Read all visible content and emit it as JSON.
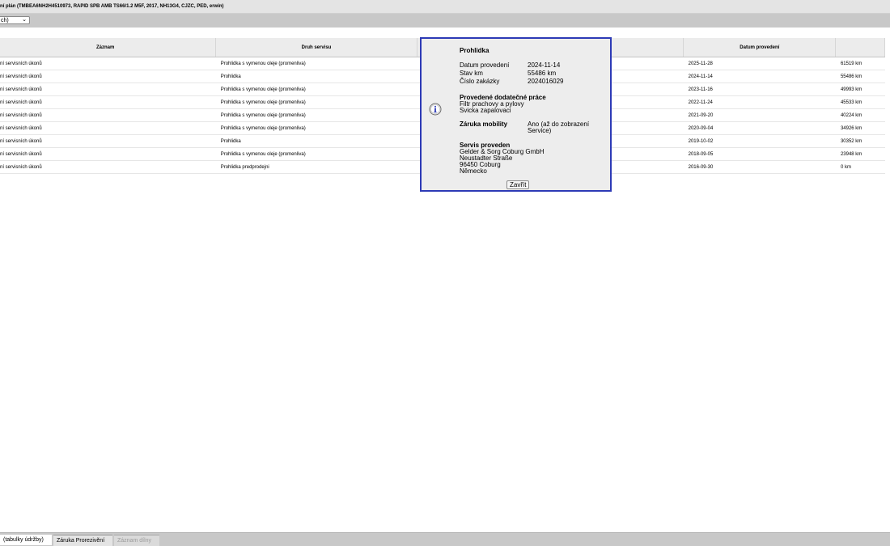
{
  "window": {
    "title": "ní plán (TMBEA6NH2H4510973, RAPID SPB AMB TS66/1.2 M5F, 2017, NH13G4, CJZC, PED, erwin)"
  },
  "toolbar": {
    "filter_value": "ch)"
  },
  "table": {
    "headers": [
      "Záznam",
      "Druh servisu",
      "",
      "Datum provedení",
      ""
    ],
    "rows": [
      {
        "record": "ní servisních úkonů",
        "type": "Prohlidka s vymenou oleje (promenliva)",
        "date": "2025-11-28",
        "km": "61519 km"
      },
      {
        "record": "ní servisních úkonů",
        "type": "Prohlidka",
        "date": "2024-11-14",
        "km": "55486 km"
      },
      {
        "record": "ní servisních úkonů",
        "type": "Prohlidka s vymenou oleje (promenliva)",
        "date": "2023-11-16",
        "km": "49993 km"
      },
      {
        "record": "ní servisních úkonů",
        "type": "Prohlidka s vymenou oleje (promenliva)",
        "date": "2022-11-24",
        "km": "45533 km"
      },
      {
        "record": "ní servisních úkonů",
        "type": "Prohlidka s vymenou oleje (promenliva)",
        "date": "2021-09-20",
        "km": "40224 km"
      },
      {
        "record": "ní servisních úkonů",
        "type": "Prohlidka s vymenou oleje (promenliva)",
        "date": "2020-09-04",
        "km": "34926 km"
      },
      {
        "record": "ní servisních úkonů",
        "type": "Prohlidka",
        "date": "2019-10-02",
        "km": "30352 km"
      },
      {
        "record": "ní servisních úkonů",
        "type": "Prohlidka s vymenou oleje (promenliva)",
        "date": "2018-09-05",
        "km": "23948 km"
      },
      {
        "record": "ní servisních úkonů",
        "type": "Prohlidka predprodejni",
        "date": "2016-09-30",
        "km": "0 km"
      }
    ]
  },
  "popup": {
    "title": "Prohlidka",
    "date_label": "Datum provedení",
    "date_value": "2024-11-14",
    "km_label": "Stav km",
    "km_value": "55486 km",
    "order_label": "Číslo zakázky",
    "order_value": "2024016029",
    "extra_heading": "Provedené dodatečné práce",
    "extra_items": [
      "Filtr prachovy a pylovy",
      "Svicka zapalovaci"
    ],
    "mobility_label": "Záruka mobility",
    "mobility_value_line1": "Ano (až do zobrazení",
    "mobility_value_line2": "Service)",
    "service_heading": "Servis proveden",
    "service_lines": [
      "Gelder & Sorg Coburg GmbH",
      "Neustadter Straße",
      "96450 Coburg",
      "Německo"
    ],
    "close_label": "Zavřít",
    "icon": "info-icon",
    "border_color": "#2d3ab6"
  },
  "tabs": [
    {
      "label": "(tabulky údržby)",
      "state": "active"
    },
    {
      "label": "Záruka Prorezivění",
      "state": "inactive"
    },
    {
      "label": "Záznam dílny",
      "state": "disabled"
    }
  ]
}
